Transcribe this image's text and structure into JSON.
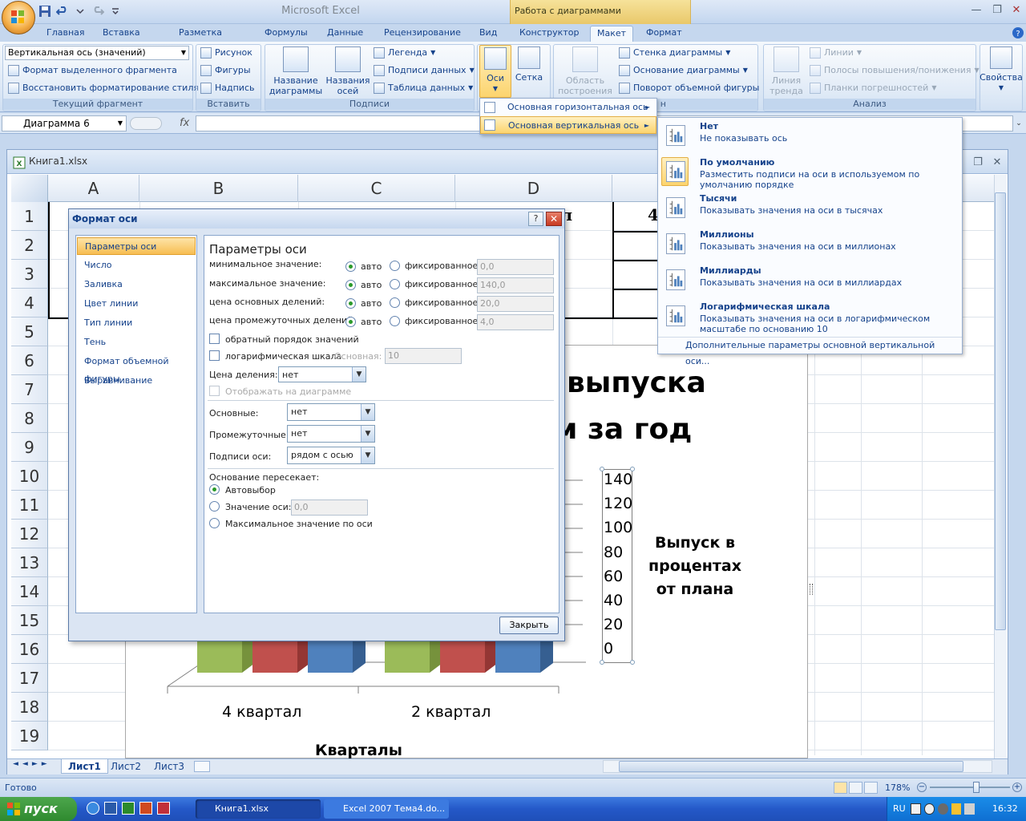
{
  "app": {
    "title": "Microsoft Excel",
    "context_title": "Работа с диаграммами"
  },
  "tabs": [
    "Главная",
    "Вставка",
    "Разметка страницы",
    "Формулы",
    "Данные",
    "Рецензирование",
    "Вид",
    "Конструктор",
    "Макет",
    "Формат"
  ],
  "active_tab": "Макет",
  "ribbon": {
    "current": {
      "selector": "Вертикальная ось (значений)",
      "format_selection": "Формат выделенного фрагмента",
      "reset_style": "Восстановить форматирование стиля",
      "label": "Текущий фрагмент"
    },
    "insert": {
      "picture": "Рисунок",
      "shapes": "Фигуры",
      "textbox": "Надпись",
      "label": "Вставить"
    },
    "labels": {
      "chart_title": "Название диаграммы",
      "axis_titles": "Названия осей",
      "legend": "Легенда",
      "data_labels": "Подписи данных",
      "data_table": "Таблица данных",
      "label": "Подписи"
    },
    "axes": {
      "axes": "Оси",
      "grid": "Сетка"
    },
    "background": {
      "plot_area": "Область построения",
      "chart_wall": "Стенка диаграммы",
      "chart_floor": "Основание диаграммы",
      "rotation": "Поворот объемной фигуры",
      "label_tail": "н"
    },
    "analysis": {
      "trendline": "Линия тренда",
      "lines": "Линии",
      "updown": "Полосы повышения/понижения",
      "errorbars": "Планки погрешностей",
      "label": "Анализ"
    },
    "properties": {
      "label": "Свойства"
    }
  },
  "formula_bar": {
    "name": "Диаграмма 6",
    "fx": "fx",
    "value": ""
  },
  "workbook": {
    "title": "Книга1.xlsx"
  },
  "columns": [
    "A",
    "B",
    "C",
    "D"
  ],
  "rows": [
    "1",
    "2",
    "3",
    "4",
    "5",
    "6",
    "7",
    "8",
    "9",
    "10",
    "11",
    "12",
    "13",
    "14",
    "15",
    "16",
    "17",
    "18",
    "19"
  ],
  "cells": {
    "c1_partial": "л",
    "e1_partial": "4"
  },
  "chart": {
    "title_line1": "выпуска",
    "title_line2": "м за год",
    "axis_labels": [
      "140",
      "120",
      "100",
      "80",
      "60",
      "40",
      "20",
      "0"
    ],
    "ylabel": "Выпуск в процентах от плана",
    "categories": [
      "4 квартал",
      "2 квартал"
    ],
    "xlabel": "Кварталы",
    "colors": {
      "green": "#9bbb59",
      "red": "#c0504d",
      "blue": "#4f81bd"
    }
  },
  "chart_data": {
    "type": "bar",
    "categories": [
      "4 квартал",
      "2 квартал"
    ],
    "ylim": [
      0,
      140
    ],
    "xlabel": "Кварталы",
    "ylabel": "Выпуск в процентах от плана",
    "y_ticks": [
      0,
      20,
      40,
      60,
      80,
      100,
      120,
      140
    ]
  },
  "dialog": {
    "title": "Формат оси",
    "help": "?",
    "nav": [
      "Параметры оси",
      "Число",
      "Заливка",
      "Цвет линии",
      "Тип линии",
      "Тень",
      "Формат объемной фигуры",
      "Выравнивание"
    ],
    "section": "Параметры оси",
    "min_label": "минимальное значение:",
    "max_label": "максимальное значение:",
    "major_label": "цена основных делений:",
    "minor_label": "цена промежуточных делений:",
    "auto": "авто",
    "fixed": "фиксированное",
    "min_value": "0,0",
    "max_value": "140,0",
    "major_value": "20,0",
    "minor_value": "4,0",
    "reverse": "обратный порядок значений",
    "log": "логарифмическая шкала",
    "log_base_label": "Основная:",
    "log_base": "10",
    "display_units_label": "Цена деления:",
    "display_units": "нет",
    "show_on_chart": "Отображать на диаграмме",
    "major_tick_label": "Основные:",
    "major_tick": "нет",
    "minor_tick_label": "Промежуточные:",
    "minor_tick": "нет",
    "axis_labels_label": "Подписи оси:",
    "axis_labels": "рядом с осью",
    "cross_label": "Основание пересекает:",
    "cross_auto": "Автовыбор",
    "cross_value_label": "Значение оси:",
    "cross_value": "0,0",
    "cross_max": "Максимальное значение по оси",
    "close": "Закрыть"
  },
  "menu1": {
    "horizontal": "Основная горизонтальная ось",
    "vertical": "Основная вертикальная ось"
  },
  "menu2": {
    "items": [
      {
        "title": "Нет",
        "desc": "Не показывать ось"
      },
      {
        "title": "По умолчанию",
        "desc": "Разместить подписи на оси в используемом по умолчанию порядке"
      },
      {
        "title": "Тысячи",
        "desc": "Показывать значения на оси в тысячах"
      },
      {
        "title": "Миллионы",
        "desc": "Показывать значения на оси в миллионах"
      },
      {
        "title": "Миллиарды",
        "desc": "Показывать значения на оси в миллиардах"
      },
      {
        "title": "Логарифмическая шкала",
        "desc": "Показывать значения на оси в логарифмическом масштабе по основанию 10"
      }
    ],
    "more": "Дополнительные параметры основной вертикальной оси..."
  },
  "sheets": [
    "Лист1",
    "Лист2",
    "Лист3"
  ],
  "status": {
    "ready": "Готово",
    "zoom": "178%"
  },
  "taskbar": {
    "start": "пуск",
    "task1": "Книга1.xlsx",
    "task2": "Excel 2007 Тема4.do...",
    "lang": "RU",
    "time": "16:32"
  }
}
